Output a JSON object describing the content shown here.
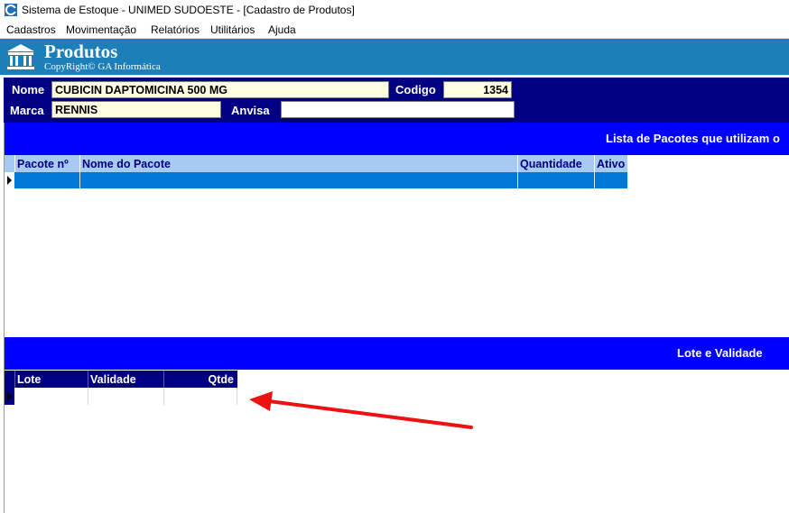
{
  "window": {
    "title": "Sistema de Estoque - UNIMED SUDOESTE - [Cadastro de Produtos]"
  },
  "menu": [
    {
      "label": "Cadastros"
    },
    {
      "label": "Movimentação"
    },
    {
      "label": "Relatórios"
    },
    {
      "label": "Utilitários"
    },
    {
      "label": "Ajuda"
    }
  ],
  "banner": {
    "title": "Produtos",
    "subtitle": "CopyRight© GA Informática"
  },
  "form": {
    "nome_label": "Nome",
    "nome_value": "CUBICIN DAPTOMICINA 500 MG",
    "codigo_label": "Codigo",
    "codigo_value": "1354",
    "marca_label": "Marca",
    "marca_value": "RENNIS",
    "anvisa_label": "Anvisa",
    "anvisa_value": ""
  },
  "pacotes": {
    "title": "Lista de Pacotes que utilizam o",
    "columns": [
      "Pacote nº",
      "Nome do Pacote",
      "Quantidade",
      "Ativo"
    ]
  },
  "lotes": {
    "title": "Lote e Validade",
    "columns": [
      "Lote",
      "Validade",
      "Qtde"
    ]
  },
  "colors": {
    "banner": "#1c7fb8",
    "form_bg": "#000080",
    "section_bar": "#0000ff",
    "grid_header": "#a6caf0",
    "grid_selected_row": "#0078d7",
    "input_bg": "#ffffe1",
    "annotation_arrow": "#ee1111"
  }
}
